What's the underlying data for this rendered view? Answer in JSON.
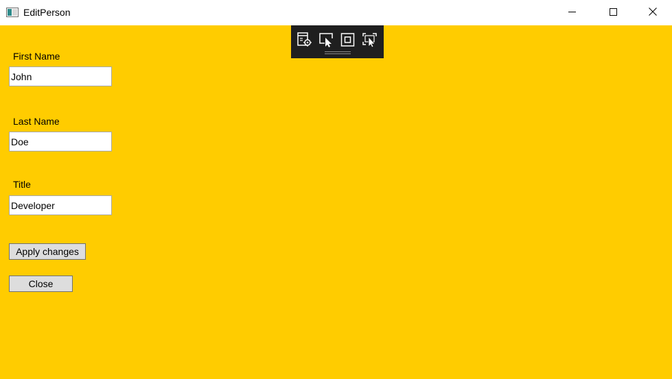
{
  "window": {
    "title": "EditPerson",
    "background_color": "#ffcc00",
    "app_icon": "window-app-icon",
    "caption_buttons": [
      "minimize-icon",
      "maximize-icon",
      "close-icon"
    ]
  },
  "debug_toolbar": {
    "buttons": [
      "live-visual-tree-icon",
      "select-element-icon",
      "display-layout-adorners-icon",
      "track-focused-element-icon"
    ]
  },
  "form": {
    "first_name": {
      "label": "First Name",
      "value": "John"
    },
    "last_name": {
      "label": "Last Name",
      "value": "Doe"
    },
    "title": {
      "label": "Title",
      "value": "Developer"
    }
  },
  "actions": {
    "apply_label": "Apply changes",
    "close_label": "Close"
  }
}
